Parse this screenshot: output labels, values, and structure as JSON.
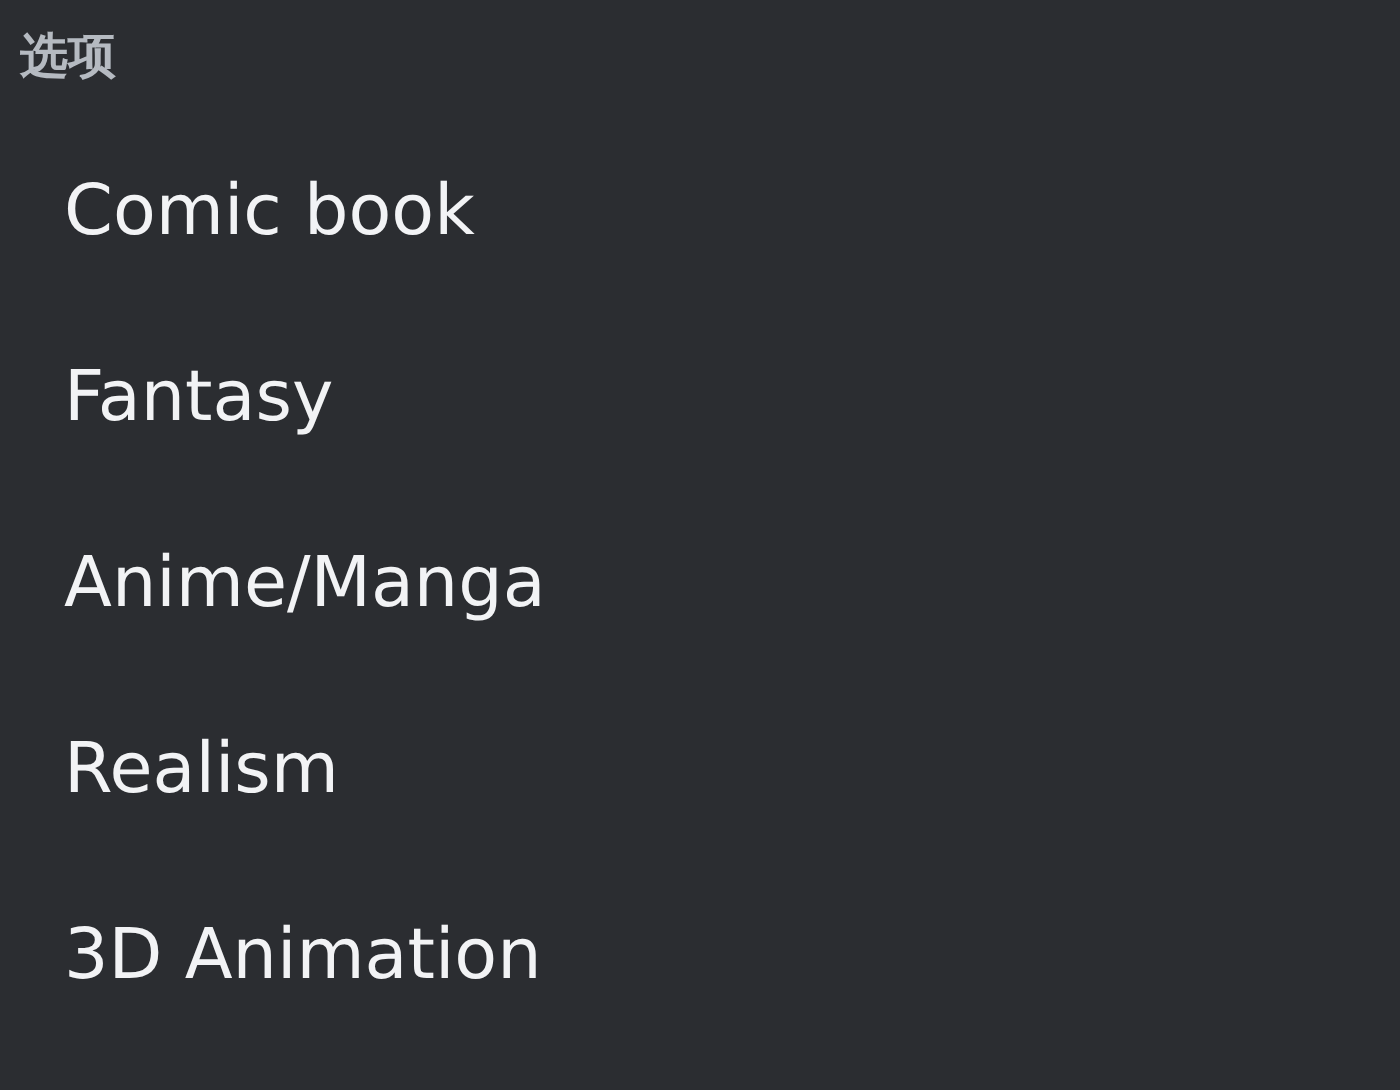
{
  "header": {
    "title": "选项"
  },
  "options": [
    {
      "label": "Comic book"
    },
    {
      "label": "Fantasy"
    },
    {
      "label": "Anime/Manga"
    },
    {
      "label": "Realism"
    },
    {
      "label": "3D Animation"
    }
  ]
}
